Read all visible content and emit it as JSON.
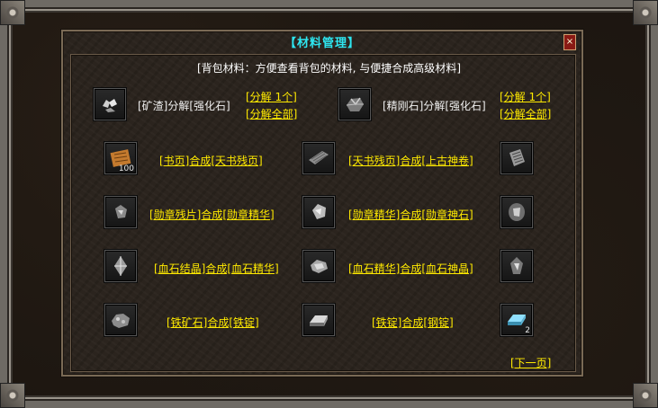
{
  "window": {
    "title": "【材料管理】",
    "close_label": "×"
  },
  "header": "[背包材料：方便查看背包的材料, 与便捷合成高级材料]",
  "decompose": [
    {
      "icon": "ore-slag-icon",
      "label": "[矿渣]分解[强化石]",
      "link_one": "[分解 1个]",
      "link_all": "[分解全部]"
    },
    {
      "icon": "diamond-ore-icon",
      "label": "[精刚石]分解[强化石]",
      "link_one": "[分解 1个]",
      "link_all": "[分解全部]"
    }
  ],
  "craft_rows": [
    {
      "left_icon": "book-page-icon",
      "left_count": "100",
      "left_link": "[书页]合成[天书残页]",
      "mid_icon": "scroll-fragment-icon",
      "right_link": "[天书残页]合成[上古神卷]",
      "right_icon": "ancient-scroll-icon",
      "right_count": ""
    },
    {
      "left_icon": "medal-shard-icon",
      "left_count": "",
      "left_link": "[勋章残片]合成[勋章精华]",
      "mid_icon": "medal-essence-icon",
      "right_link": "[勋章精华]合成[勋章神石]",
      "right_icon": "medal-stone-icon",
      "right_count": ""
    },
    {
      "left_icon": "blood-crystal-icon",
      "left_count": "",
      "left_link": "[血石结晶]合成[血石精华]",
      "mid_icon": "blood-essence-icon",
      "right_link": "[血石精华]合成[血石神晶]",
      "right_icon": "blood-god-crystal-icon",
      "right_count": ""
    },
    {
      "left_icon": "iron-ore-icon",
      "left_count": "",
      "left_link": "[铁矿石]合成[铁锭]",
      "mid_icon": "iron-ingot-icon",
      "right_link": "[铁锭]合成[钢锭]",
      "right_icon": "steel-ingot-icon",
      "right_count": "2"
    }
  ],
  "next_page": "[下一页]"
}
